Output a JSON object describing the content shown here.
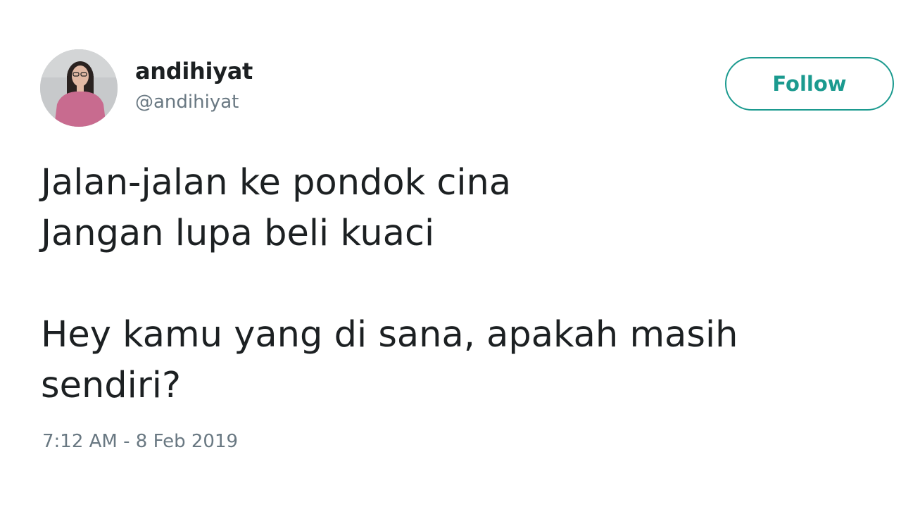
{
  "tweet": {
    "author": {
      "display_name": "andihiyat",
      "handle": "@andihiyat"
    },
    "follow_label": "Follow",
    "text_lines": [
      "Jalan-jalan ke pondok cina",
      "Jangan lupa beli kuaci",
      "",
      "Hey kamu yang di sana, apakah masih",
      "sendiri?"
    ],
    "timestamp": "7:12 AM - 8 Feb 2019"
  },
  "colors": {
    "accent": "#1b9a8f",
    "text": "#1c2022",
    "muted": "#697882",
    "background": "#ffffff"
  },
  "icons": {
    "avatar": "profile-photo-avatar"
  }
}
